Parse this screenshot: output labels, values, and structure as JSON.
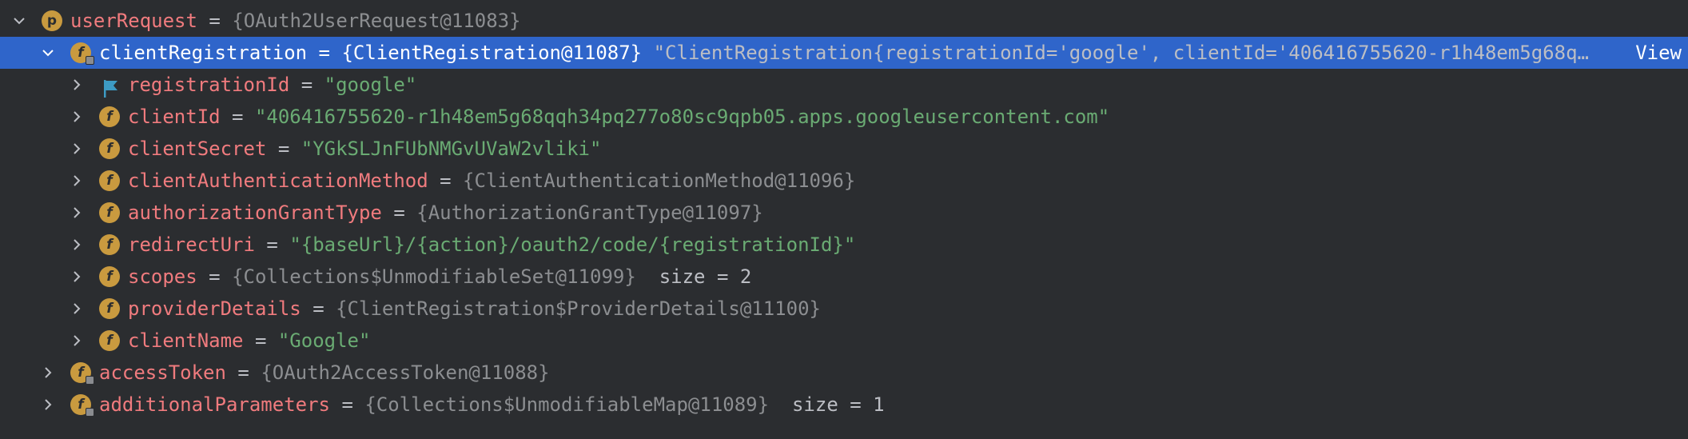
{
  "rows": [
    {
      "name": "userRequest",
      "eq": "=",
      "value": "{OAuth2UserRequest@11083}",
      "badge": "p",
      "expanded": true
    },
    {
      "name": "clientRegistration",
      "eq": "=",
      "value": "{ClientRegistration@11087}",
      "extra": "\"ClientRegistration{registrationId='google', clientId='406416755620-r1h48em5g68q…",
      "view_label": "View",
      "badge": "f",
      "expanded": true,
      "selected": true
    },
    {
      "name": "registrationId",
      "eq": "=",
      "value": "\"google\"",
      "icon": "flag-icon"
    },
    {
      "name": "clientId",
      "eq": "=",
      "value": "\"406416755620-r1h48em5g68qqh34pq277o80sc9qpb05.apps.googleusercontent.com\"",
      "badge": "f"
    },
    {
      "name": "clientSecret",
      "eq": "=",
      "value": "\"YGkSLJnFUbNMGvUVaW2vliki\"",
      "badge": "f"
    },
    {
      "name": "clientAuthenticationMethod",
      "eq": "=",
      "value": "{ClientAuthenticationMethod@11096}",
      "badge": "f"
    },
    {
      "name": "authorizationGrantType",
      "eq": "=",
      "value": "{AuthorizationGrantType@11097}",
      "badge": "f"
    },
    {
      "name": "redirectUri",
      "eq": "=",
      "value": "\"{baseUrl}/{action}/oauth2/code/{registrationId}\"",
      "badge": "f"
    },
    {
      "name": "scopes",
      "eq": "=",
      "value": "{Collections$UnmodifiableSet@11099}",
      "extra": "size = 2",
      "badge": "f"
    },
    {
      "name": "providerDetails",
      "eq": "=",
      "value": "{ClientRegistration$ProviderDetails@11100}",
      "badge": "f"
    },
    {
      "name": "clientName",
      "eq": "=",
      "value": "\"Google\"",
      "badge": "f"
    },
    {
      "name": "accessToken",
      "eq": "=",
      "value": "{OAuth2AccessToken@11088}",
      "badge": "f"
    },
    {
      "name": "additionalParameters",
      "eq": "=",
      "value": "{Collections$UnmodifiableMap@11089}",
      "extra": "size = 1",
      "badge": "f"
    }
  ],
  "colors": {
    "background": "#2b2d30",
    "selection": "#2f65ca",
    "field_name": "#f07b7e",
    "string_value": "#6aab73",
    "reference_value": "#8c8e91",
    "badge": "#c99a3f",
    "flag": "#3d9bc4"
  },
  "icons": {
    "expand": "chevron-right-icon",
    "collapse": "chevron-down-icon",
    "field": "field-icon",
    "parameter": "parameter-icon",
    "marker": "flag-icon"
  }
}
